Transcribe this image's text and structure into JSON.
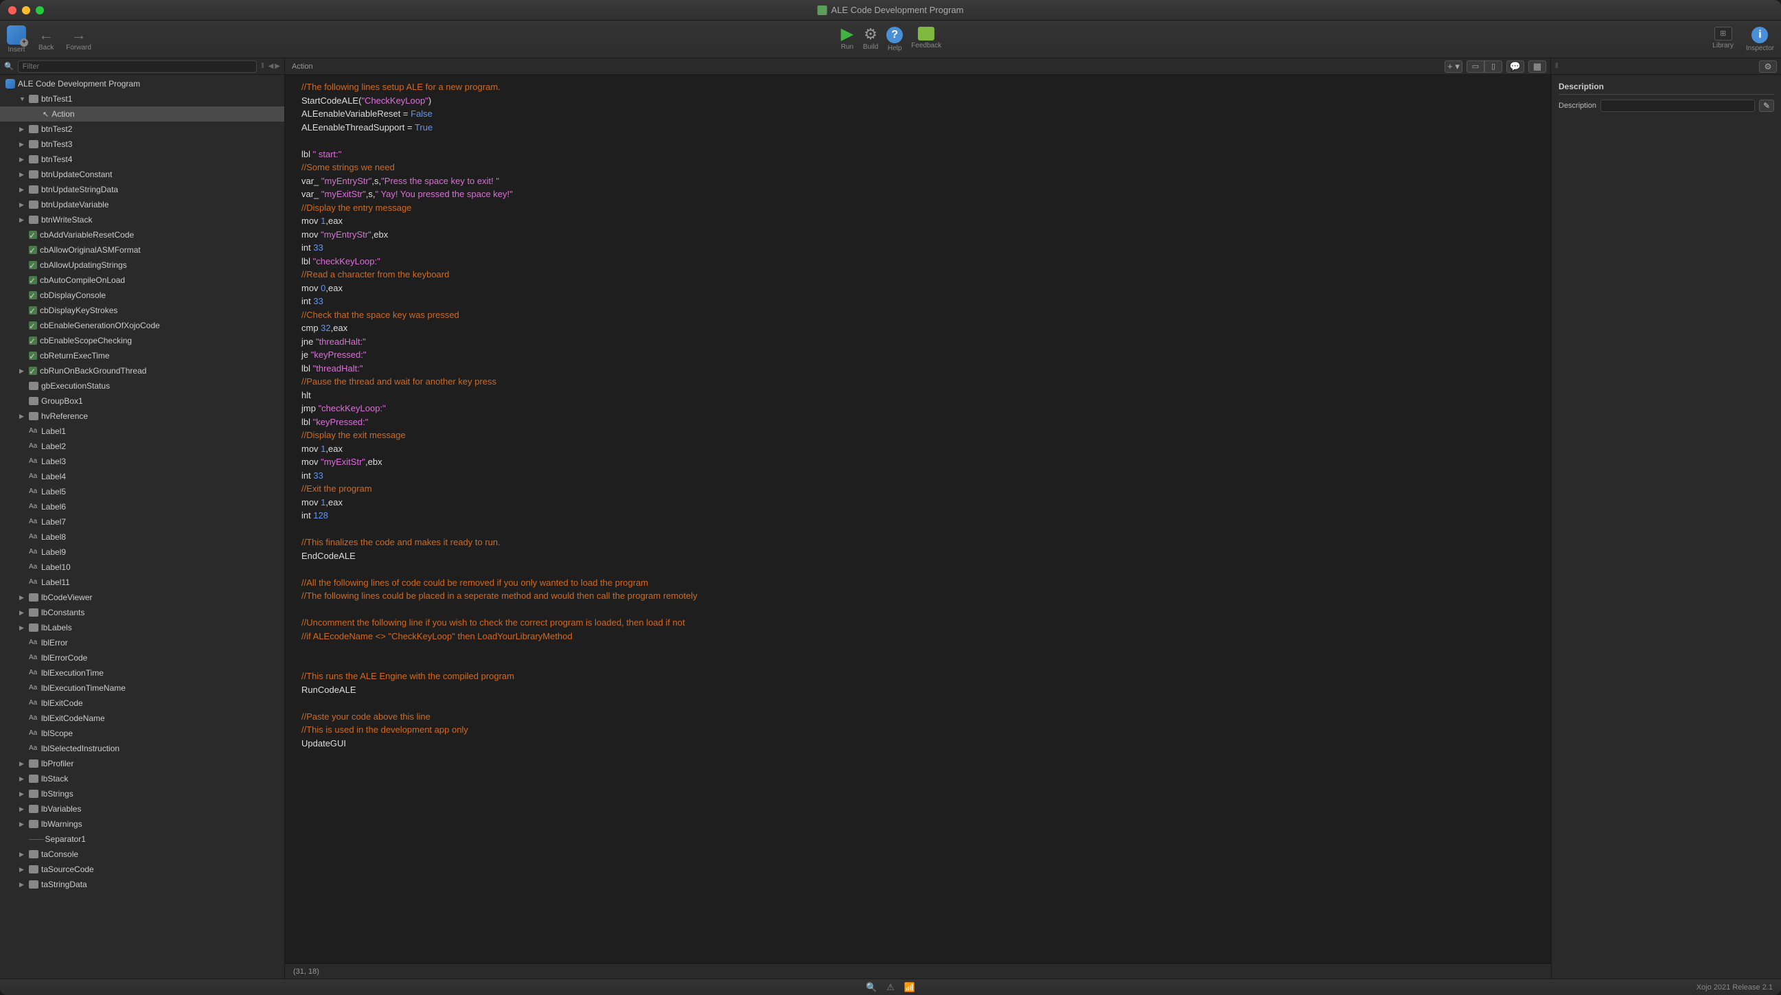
{
  "window_title": "ALE Code Development Program",
  "toolbar": {
    "insert": "Insert",
    "back": "Back",
    "forward": "Forward",
    "run": "Run",
    "build": "Build",
    "help": "Help",
    "feedback": "Feedback",
    "library": "Library",
    "inspector": "Inspector"
  },
  "filter_placeholder": "Filter",
  "breadcrumb": "Action",
  "project_root": "ALE Code Development Program",
  "tree": [
    {
      "label": "btnTest1",
      "icon": "folder",
      "level": 1,
      "expand": true,
      "children": [
        {
          "label": "Action",
          "icon": "cursor",
          "level": 2,
          "selected": true
        }
      ]
    },
    {
      "label": "btnTest2",
      "icon": "folder",
      "level": 1,
      "expand": false
    },
    {
      "label": "btnTest3",
      "icon": "folder",
      "level": 1,
      "expand": false
    },
    {
      "label": "btnTest4",
      "icon": "folder",
      "level": 1,
      "expand": false
    },
    {
      "label": "btnUpdateConstant",
      "icon": "folder",
      "level": 1,
      "expand": false
    },
    {
      "label": "btnUpdateStringData",
      "icon": "folder",
      "level": 1,
      "expand": false
    },
    {
      "label": "btnUpdateVariable",
      "icon": "folder",
      "level": 1,
      "expand": false
    },
    {
      "label": "btnWriteStack",
      "icon": "folder",
      "level": 1,
      "expand": false
    },
    {
      "label": "cbAddVariableResetCode",
      "icon": "cb",
      "level": 1
    },
    {
      "label": "cbAllowOriginalASMFormat",
      "icon": "cb",
      "level": 1
    },
    {
      "label": "cbAllowUpdatingStrings",
      "icon": "cb",
      "level": 1
    },
    {
      "label": "cbAutoCompileOnLoad",
      "icon": "cb",
      "level": 1
    },
    {
      "label": "cbDisplayConsole",
      "icon": "cb",
      "level": 1
    },
    {
      "label": "cbDisplayKeyStrokes",
      "icon": "cb",
      "level": 1
    },
    {
      "label": "cbEnableGenerationOfXojoCode",
      "icon": "cb",
      "level": 1
    },
    {
      "label": "cbEnableScopeChecking",
      "icon": "cb",
      "level": 1
    },
    {
      "label": "cbReturnExecTime",
      "icon": "cb",
      "level": 1
    },
    {
      "label": "cbRunOnBackGroundThread",
      "icon": "cb",
      "level": 1,
      "expand": false
    },
    {
      "label": "gbExecutionStatus",
      "icon": "folder",
      "level": 1
    },
    {
      "label": "GroupBox1",
      "icon": "folder",
      "level": 1
    },
    {
      "label": "hvReference",
      "icon": "folder",
      "level": 1,
      "expand": false
    },
    {
      "label": "Label1",
      "icon": "aa",
      "level": 1
    },
    {
      "label": "Label2",
      "icon": "aa",
      "level": 1
    },
    {
      "label": "Label3",
      "icon": "aa",
      "level": 1
    },
    {
      "label": "Label4",
      "icon": "aa",
      "level": 1
    },
    {
      "label": "Label5",
      "icon": "aa",
      "level": 1
    },
    {
      "label": "Label6",
      "icon": "aa",
      "level": 1
    },
    {
      "label": "Label7",
      "icon": "aa",
      "level": 1
    },
    {
      "label": "Label8",
      "icon": "aa",
      "level": 1
    },
    {
      "label": "Label9",
      "icon": "aa",
      "level": 1
    },
    {
      "label": "Label10",
      "icon": "aa",
      "level": 1
    },
    {
      "label": "Label11",
      "icon": "aa",
      "level": 1
    },
    {
      "label": "lbCodeViewer",
      "icon": "folder",
      "level": 1,
      "expand": false
    },
    {
      "label": "lbConstants",
      "icon": "folder",
      "level": 1,
      "expand": false
    },
    {
      "label": "lbLabels",
      "icon": "folder",
      "level": 1,
      "expand": false
    },
    {
      "label": "lblError",
      "icon": "aa",
      "level": 1
    },
    {
      "label": "lblErrorCode",
      "icon": "aa",
      "level": 1
    },
    {
      "label": "lblExecutionTime",
      "icon": "aa",
      "level": 1
    },
    {
      "label": "lblExecutionTimeName",
      "icon": "aa",
      "level": 1
    },
    {
      "label": "lblExitCode",
      "icon": "aa",
      "level": 1
    },
    {
      "label": "lblExitCodeName",
      "icon": "aa",
      "level": 1
    },
    {
      "label": "lblScope",
      "icon": "aa",
      "level": 1
    },
    {
      "label": "lblSelectedInstruction",
      "icon": "aa",
      "level": 1
    },
    {
      "label": "lbProfiler",
      "icon": "folder",
      "level": 1,
      "expand": false
    },
    {
      "label": "lbStack",
      "icon": "folder",
      "level": 1,
      "expand": false
    },
    {
      "label": "lbStrings",
      "icon": "folder",
      "level": 1,
      "expand": false
    },
    {
      "label": "lbVariables",
      "icon": "folder",
      "level": 1,
      "expand": false
    },
    {
      "label": "lbWarnings",
      "icon": "folder",
      "level": 1,
      "expand": false
    },
    {
      "label": "Separator1",
      "icon": "sep",
      "level": 1
    },
    {
      "label": "taConsole",
      "icon": "folder",
      "level": 1,
      "expand": false
    },
    {
      "label": "taSourceCode",
      "icon": "folder",
      "level": 1,
      "expand": false
    },
    {
      "label": "taStringData",
      "icon": "folder",
      "level": 1,
      "expand": false
    }
  ],
  "code": [
    {
      "t": "//The following lines setup ALE for a new program.",
      "c": "comment"
    },
    {
      "segments": [
        {
          "t": "StartCodeALE("
        },
        {
          "t": "\"CheckKeyLoop\"",
          "c": "string"
        },
        {
          "t": ")"
        }
      ]
    },
    {
      "segments": [
        {
          "t": "ALEenableVariableReset = "
        },
        {
          "t": "False",
          "c": "keyword"
        }
      ]
    },
    {
      "segments": [
        {
          "t": "ALEenableThreadSupport = "
        },
        {
          "t": "True",
          "c": "keyword"
        }
      ]
    },
    {
      "t": ""
    },
    {
      "segments": [
        {
          "t": "lbl "
        },
        {
          "t": "\" start:\"",
          "c": "string"
        }
      ]
    },
    {
      "t": "//Some strings we need",
      "c": "comment"
    },
    {
      "segments": [
        {
          "t": "var_ "
        },
        {
          "t": "\"myEntryStr\"",
          "c": "string"
        },
        {
          "t": ",s,"
        },
        {
          "t": "\"Press the space key to exit! \"",
          "c": "string"
        }
      ]
    },
    {
      "segments": [
        {
          "t": "var_ "
        },
        {
          "t": "\"myExitStr\"",
          "c": "string"
        },
        {
          "t": ",s,"
        },
        {
          "t": "\" Yay! You pressed the space key!\"",
          "c": "string"
        }
      ]
    },
    {
      "t": "//Display the entry message",
      "c": "comment"
    },
    {
      "segments": [
        {
          "t": "mov "
        },
        {
          "t": "1",
          "c": "number"
        },
        {
          "t": ",eax"
        }
      ]
    },
    {
      "segments": [
        {
          "t": "mov "
        },
        {
          "t": "\"myEntryStr\"",
          "c": "string"
        },
        {
          "t": ",ebx"
        }
      ]
    },
    {
      "segments": [
        {
          "t": "int "
        },
        {
          "t": "33",
          "c": "number"
        }
      ]
    },
    {
      "segments": [
        {
          "t": "lbl "
        },
        {
          "t": "\"checkKeyLoop:\"",
          "c": "string"
        }
      ]
    },
    {
      "t": "//Read a character from the keyboard",
      "c": "comment"
    },
    {
      "segments": [
        {
          "t": "mov "
        },
        {
          "t": "0",
          "c": "number"
        },
        {
          "t": ",eax"
        }
      ]
    },
    {
      "segments": [
        {
          "t": "int "
        },
        {
          "t": "33",
          "c": "number"
        }
      ]
    },
    {
      "t": "//Check that the space key was pressed",
      "c": "comment"
    },
    {
      "segments": [
        {
          "t": "cmp "
        },
        {
          "t": "32",
          "c": "number"
        },
        {
          "t": ",eax"
        }
      ]
    },
    {
      "segments": [
        {
          "t": "jne "
        },
        {
          "t": "\"threadHalt:\"",
          "c": "string"
        }
      ]
    },
    {
      "segments": [
        {
          "t": "je "
        },
        {
          "t": "\"keyPressed:\"",
          "c": "string"
        }
      ]
    },
    {
      "segments": [
        {
          "t": "lbl "
        },
        {
          "t": "\"threadHalt:\"",
          "c": "string"
        }
      ]
    },
    {
      "t": "//Pause the thread and wait for another key press",
      "c": "comment"
    },
    {
      "t": "hlt"
    },
    {
      "segments": [
        {
          "t": "jmp "
        },
        {
          "t": "\"checkKeyLoop:\"",
          "c": "string"
        }
      ]
    },
    {
      "segments": [
        {
          "t": "lbl "
        },
        {
          "t": "\"keyPressed:\"",
          "c": "string"
        }
      ]
    },
    {
      "t": "//Display the exit message",
      "c": "comment"
    },
    {
      "segments": [
        {
          "t": "mov "
        },
        {
          "t": "1",
          "c": "number"
        },
        {
          "t": ",eax"
        }
      ]
    },
    {
      "segments": [
        {
          "t": "mov "
        },
        {
          "t": "\"myExitStr\"",
          "c": "string"
        },
        {
          "t": ",ebx"
        }
      ]
    },
    {
      "segments": [
        {
          "t": "int "
        },
        {
          "t": "33",
          "c": "number"
        }
      ]
    },
    {
      "t": "//Exit the program",
      "c": "comment"
    },
    {
      "segments": [
        {
          "t": "mov "
        },
        {
          "t": "1",
          "c": "number"
        },
        {
          "t": ",eax"
        }
      ]
    },
    {
      "segments": [
        {
          "t": "int "
        },
        {
          "t": "128",
          "c": "number"
        }
      ]
    },
    {
      "t": ""
    },
    {
      "t": "//This finalizes the code and makes it ready to run.",
      "c": "comment"
    },
    {
      "t": "EndCodeALE"
    },
    {
      "t": ""
    },
    {
      "t": "//All the following lines of code could be removed if you only wanted to load the program",
      "c": "comment"
    },
    {
      "t": "//The following lines could be placed in a seperate method and would then call the program remotely",
      "c": "comment"
    },
    {
      "t": ""
    },
    {
      "t": "//Uncomment the following line if you wish to check the correct program is loaded, then load if not",
      "c": "comment"
    },
    {
      "t": "//if ALEcodeName <> \"CheckKeyLoop\" then LoadYourLibraryMethod",
      "c": "comment"
    },
    {
      "t": ""
    },
    {
      "t": ""
    },
    {
      "t": "//This runs the ALE Engine with the compiled program",
      "c": "comment"
    },
    {
      "t": "RunCodeALE"
    },
    {
      "t": ""
    },
    {
      "t": "//Paste your code above this line",
      "c": "comment"
    },
    {
      "t": "//This is used in the development app only",
      "c": "comment"
    },
    {
      "t": "UpdateGUI"
    }
  ],
  "cursor_pos": "(31, 18)",
  "right_panel": {
    "heading": "Description",
    "label": "Description"
  },
  "footer_version": "Xojo 2021 Release 2.1"
}
